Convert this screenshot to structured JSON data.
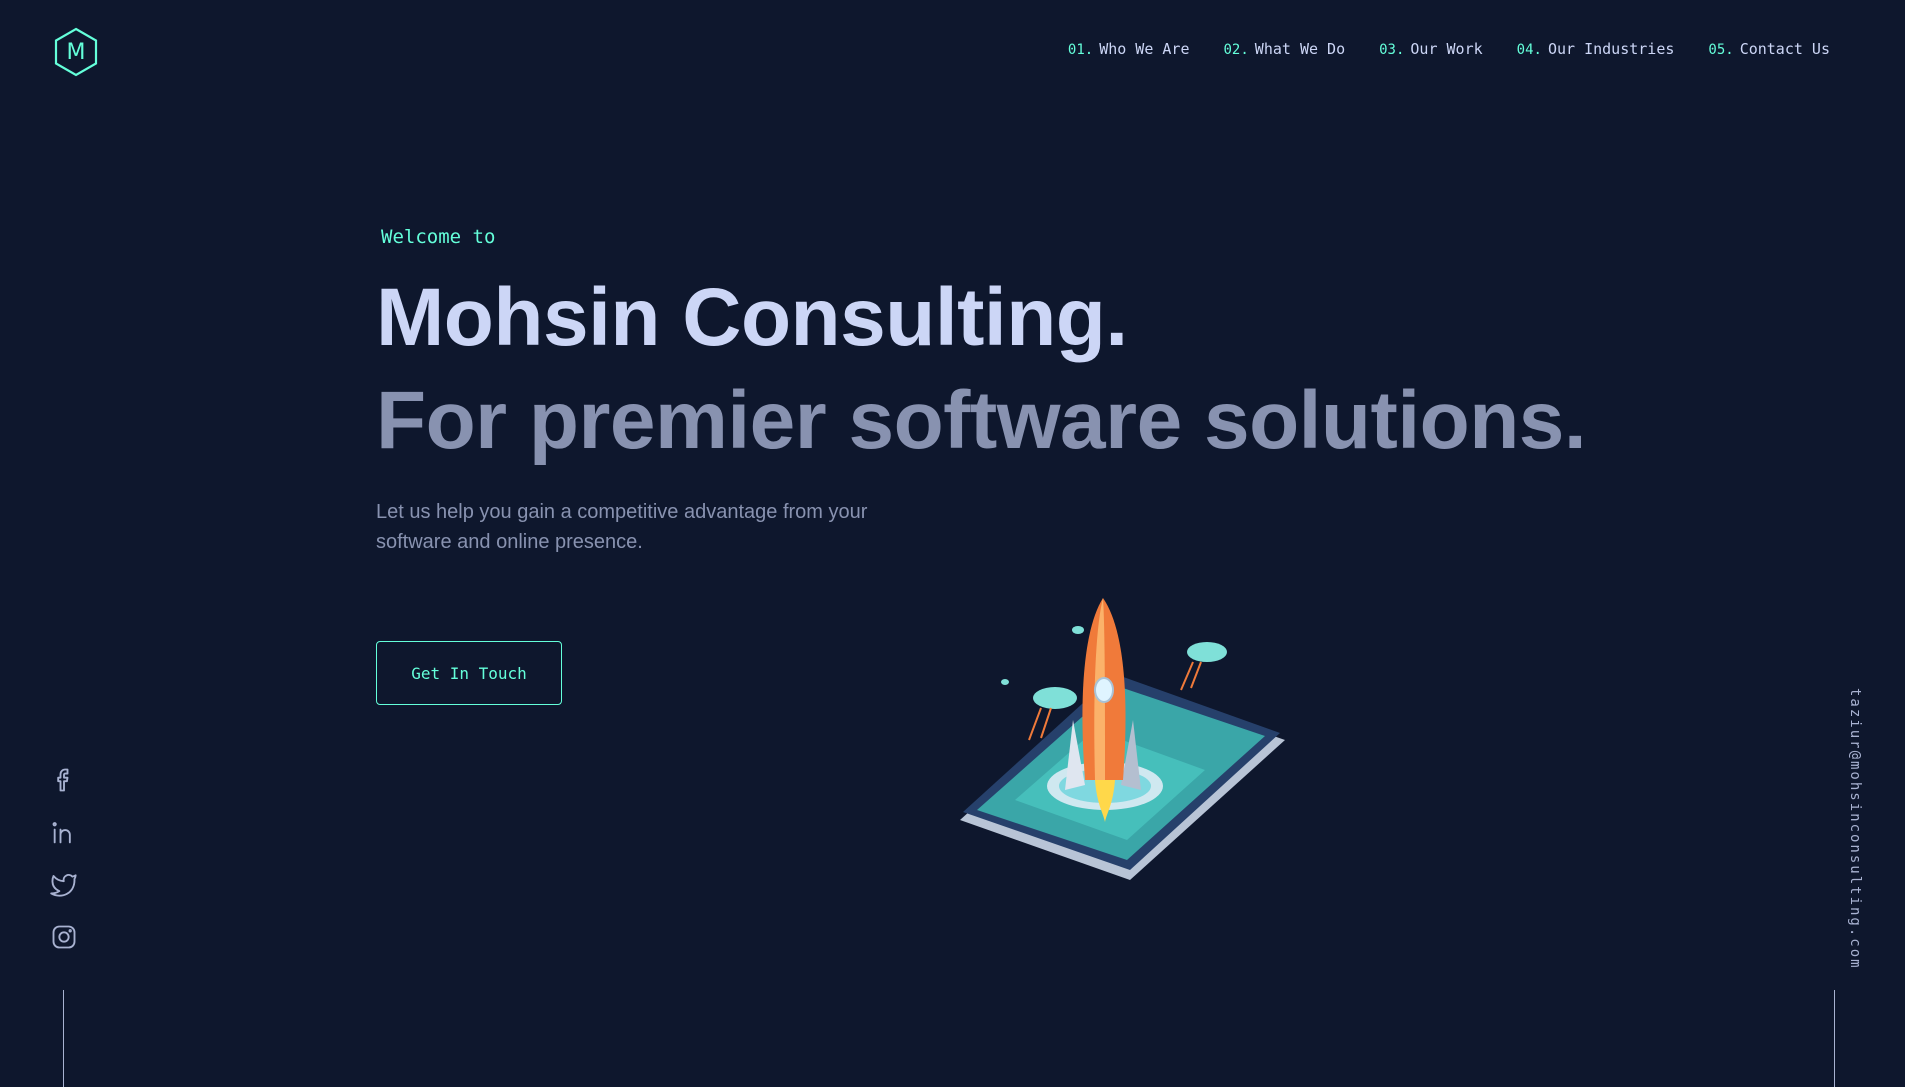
{
  "logo": {
    "letter": "M"
  },
  "nav": [
    {
      "num": "01.",
      "label": "Who We Are"
    },
    {
      "num": "02.",
      "label": "What We Do"
    },
    {
      "num": "03.",
      "label": "Our Work"
    },
    {
      "num": "04.",
      "label": "Our Industries"
    },
    {
      "num": "05.",
      "label": "Contact Us"
    }
  ],
  "hero": {
    "welcome": "Welcome to",
    "title": "Mohsin Consulting.",
    "subtitle": "For premier software solutions.",
    "description": "Let us help you gain a competitive advantage from your software and online presence.",
    "cta_label": "Get In Touch"
  },
  "social": [
    "facebook-icon",
    "linkedin-icon",
    "twitter-icon",
    "instagram-icon"
  ],
  "email": "taziur@mohsinconsulting.com",
  "colors": {
    "background": "#0e172d",
    "accent": "#64ffda",
    "heading": "#ccd6f6",
    "text": "#8892b0"
  }
}
